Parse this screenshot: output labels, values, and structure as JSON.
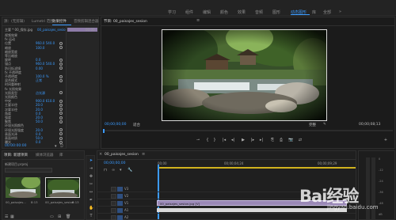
{
  "workspaces": {
    "items": [
      "学习",
      "组件",
      "编辑",
      "颜色",
      "效果",
      "音频",
      "图形",
      "库",
      "全部"
    ],
    "active_label": "动态图形",
    "more_label": "»"
  },
  "effect_controls": {
    "tabs": [
      "源：(无剪辑)",
      "Lumetri 范围",
      "效果控件",
      "音频剪辑混合器"
    ],
    "master_label": "主要 * 00_保存.jpg",
    "sequence_label": "00_paisajes_sesion...",
    "timecode_right": "00:00",
    "rows": [
      {
        "label": "视频效果",
        "value": ""
      },
      {
        "label": "fx 运动",
        "value": ""
      },
      {
        "label": "位置",
        "value": "960.0 540.0"
      },
      {
        "label": "缩放",
        "value": "100.0"
      },
      {
        "label": "缩放宽度",
        "value": ""
      },
      {
        "label": "等比缩放",
        "value": ""
      },
      {
        "label": "旋转",
        "value": "0.0"
      },
      {
        "label": "锚点",
        "value": "960.0 540.0"
      },
      {
        "label": "防闪烁滤镜",
        "value": "0.00"
      },
      {
        "label": "fx 不透明度",
        "value": ""
      },
      {
        "label": "不透明度",
        "value": "100.0 %"
      },
      {
        "label": "混合模式",
        "value": "正常"
      },
      {
        "label": "时间重映射",
        "value": ""
      },
      {
        "label": "fx 光照效果",
        "value": ""
      },
      {
        "label": "光照类型",
        "value": "点光源"
      },
      {
        "label": "光照颜色",
        "value": ""
      },
      {
        "label": "中央",
        "value": "900.0 610.0"
      },
      {
        "label": "主要半径",
        "value": "20.0"
      },
      {
        "label": "次要半径",
        "value": "20.0"
      },
      {
        "label": "角度",
        "value": "0.0"
      },
      {
        "label": "强度",
        "value": "20.0"
      },
      {
        "label": "聚焦",
        "value": "50.0"
      },
      {
        "label": "环境光照颜色",
        "value": ""
      },
      {
        "label": "环境光照强度",
        "value": "20.0"
      },
      {
        "label": "表面光泽",
        "value": "0.0"
      },
      {
        "label": "表面材质",
        "value": "50.0"
      },
      {
        "label": "曝光",
        "value": "0.0"
      }
    ],
    "footer_timecode": "00:00:00:00"
  },
  "monitor": {
    "tab_label": "节目: 00_paisajes_sesion",
    "timecode_left": "00;00;00;00",
    "fit_label": "适合",
    "quality_label": "完整",
    "timecode_right": "00;00;08;13",
    "controls": [
      "⊸",
      "{",
      "}",
      "|◂",
      "◂|",
      "▶",
      "|▸",
      "▸|",
      "⎘",
      "⎙",
      "📷",
      "⇄",
      "+"
    ]
  },
  "project": {
    "tabs": [
      "项目: 新建项目",
      "媒体浏览器",
      "库"
    ],
    "file_label": "新建项目.prproj",
    "items": [
      {
        "name": "00_paisajes...",
        "duration": "8:13"
      },
      {
        "name": "00_paisajes_sesion",
        "duration": "8:13"
      }
    ],
    "footer_icons": [
      "list-icon",
      "grid-icon",
      "slider-icon",
      "new-bin-icon",
      "trash-icon"
    ]
  },
  "timeline": {
    "tab_label": "00_paisajes_sesion",
    "timecode": "00;00;00;00",
    "ruler_labels": [
      "00;00",
      "00;00;04;24",
      "00;00;09;29"
    ],
    "tracks": [
      {
        "name": "V3",
        "type": "video"
      },
      {
        "name": "V2",
        "type": "video"
      },
      {
        "name": "V1",
        "type": "video"
      },
      {
        "name": "A1",
        "type": "audio"
      },
      {
        "name": "A2",
        "type": "audio"
      }
    ],
    "clip_label": "00_paisajes_sesion.jpg [V]"
  },
  "audio_meter": {
    "scale": [
      "0",
      "-12",
      "-24",
      "-36",
      "-48",
      "dB"
    ],
    "labels": [
      "S",
      "S"
    ]
  },
  "watermark": {
    "logo": "Bai经验",
    "url": "jingyan.baidu.com"
  },
  "colors": {
    "accent": "#3b9bff",
    "clip_violet": "#8d7ba8",
    "bg": "#1e1e1e"
  }
}
